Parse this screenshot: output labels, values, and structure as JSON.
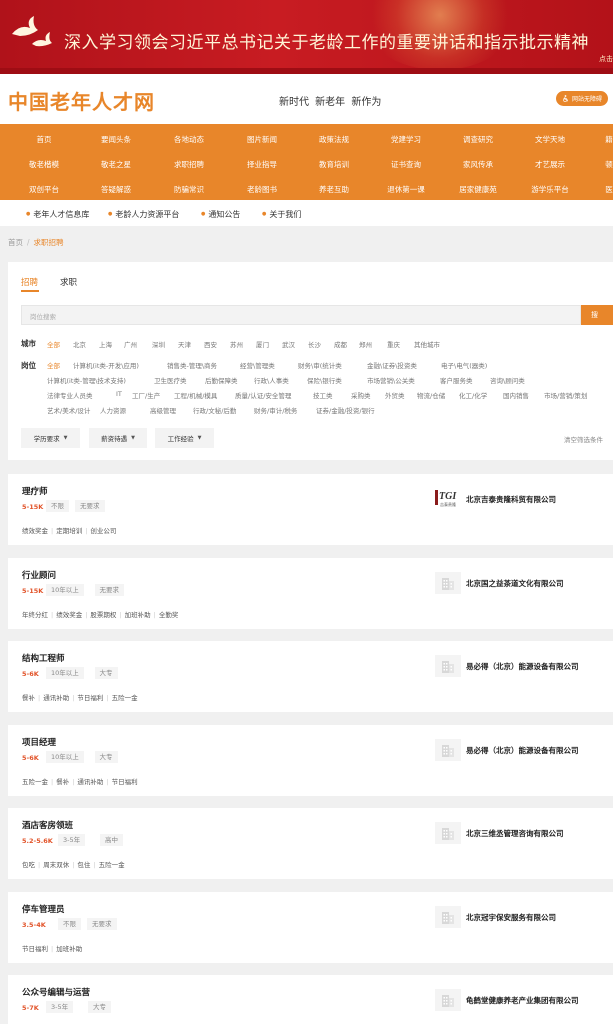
{
  "banner": {
    "title": "深入学习领会习近平总书记关于老龄工作的重要讲话和指示批示精神",
    "corner_text": "点击"
  },
  "header": {
    "logo": "中国老年人才网",
    "slogan": "新时代 新老年 新作为",
    "accessibility_label": "网站无障碍"
  },
  "nav": {
    "rows": [
      [
        "首页",
        "要闻头条",
        "各地动态",
        "图片新闻",
        "政策法规",
        "党建学习",
        "调查研究",
        "文学天地",
        "籍"
      ],
      [
        "敬老楷模",
        "敬老之星",
        "求职招聘",
        "择业指导",
        "教育培训",
        "证书查询",
        "家风传承",
        "才艺展示",
        "顿"
      ],
      [
        "双创平台",
        "答疑解惑",
        "防骗常识",
        "老龄图书",
        "养老互助",
        "退休第一课",
        "居家健康苑",
        "游学乐平台",
        "医"
      ]
    ]
  },
  "quick_links": [
    "老年人才信息库",
    "老龄人力资源平台",
    "通知公告",
    "关于我们"
  ],
  "breadcrumb": {
    "home": "首页",
    "separator": "/",
    "current": "求职招聘"
  },
  "tabs": {
    "recruit": "招聘",
    "seek": "求职"
  },
  "search": {
    "placeholder": "岗位搜索",
    "button": "搜"
  },
  "filters": {
    "city_label": "城市",
    "cities": [
      "全部",
      "北京",
      "上海",
      "广州",
      "深圳",
      "天津",
      "西安",
      "苏州",
      "厦门",
      "武汉",
      "长沙",
      "成都",
      "郑州",
      "重庆",
      "其他城市"
    ],
    "position_label": "岗位",
    "positions": [
      [
        "全部",
        "计算机(it类-开发\\应用)",
        "销售类-管理\\商务",
        "经营\\管理类",
        "财务\\审(统计类",
        "金融\\证券\\投资类",
        "电子\\电气(器类)"
      ],
      [
        "计算机(it类-管理\\技术支持)",
        "卫生医疗类",
        "后勤保障类",
        "行政\\人事类",
        "保险\\银行类",
        "市场营销\\公关类",
        "客户服务类",
        "咨询\\顾问类"
      ],
      [
        "法律专业人员类",
        "IT",
        "工厂/生产",
        "工程/机械/模具",
        "质量/认证/安全管理",
        "技工类",
        "采购类",
        "外贸类",
        "物流/仓储",
        "化工/化学",
        "国内销售",
        "市场/营销/策划"
      ],
      [
        "艺术/美术/设计",
        "人力资源",
        "高级管理",
        "行政/文秘/后勤",
        "财务/审计/税务",
        "证券/金融/投资/银行"
      ]
    ],
    "dropdowns": [
      "学历要求",
      "薪资待遇",
      "工作经验"
    ],
    "clear": "清空筛选条件"
  },
  "jobs": [
    {
      "title": "理疗师",
      "salary": "5-15K",
      "tags": [
        "不限",
        "无要求"
      ],
      "welfare": [
        "绩效奖金",
        "定期培训",
        "创业公司"
      ],
      "company": "北京吉泰贵隆科贸有限公司",
      "logo": "tgi"
    },
    {
      "title": "行业顾问",
      "salary": "5-15K",
      "tags": [
        "10年以上",
        "无要求"
      ],
      "welfare": [
        "年终分红",
        "绩效奖金",
        "股票期权",
        "加班补助",
        "全勤奖"
      ],
      "company": "北京国之益茶道文化有限公司",
      "logo": "building"
    },
    {
      "title": "结构工程师",
      "salary": "5-6K",
      "tags": [
        "10年以上",
        "大专"
      ],
      "welfare": [
        "餐补",
        "通讯补助",
        "节日福利",
        "五险一金"
      ],
      "company": "易必得（北京）能源设备有限公司",
      "logo": "building"
    },
    {
      "title": "项目经理",
      "salary": "5-6K",
      "tags": [
        "10年以上",
        "大专"
      ],
      "welfare": [
        "五险一金",
        "餐补",
        "通讯补助",
        "节日福利"
      ],
      "company": "易必得（北京）能源设备有限公司",
      "logo": "building"
    },
    {
      "title": "酒店客房领班",
      "salary": "5.2-5.6K",
      "tags": [
        "3-5年",
        "高中"
      ],
      "welfare": [
        "包吃",
        "周末双休",
        "包住",
        "五险一金"
      ],
      "company": "北京三维丞管理咨询有限公司",
      "logo": "building"
    },
    {
      "title": "停车管理员",
      "salary": "3.5-4K",
      "tags": [
        "不限",
        "无要求"
      ],
      "welfare": [
        "节日福利",
        "加班补助"
      ],
      "company": "北京冠宇保安服务有限公司",
      "logo": "building"
    },
    {
      "title": "公众号编辑与运营",
      "salary": "5-7K",
      "tags": [
        "3-5年",
        "大专"
      ],
      "welfare": [],
      "company": "龟鹤堂健康养老产业集团有限公司",
      "logo": "building"
    }
  ],
  "colors": {
    "accent": "#e8862a",
    "banner_red": "#c81c22",
    "salary_red": "#e2542a"
  }
}
